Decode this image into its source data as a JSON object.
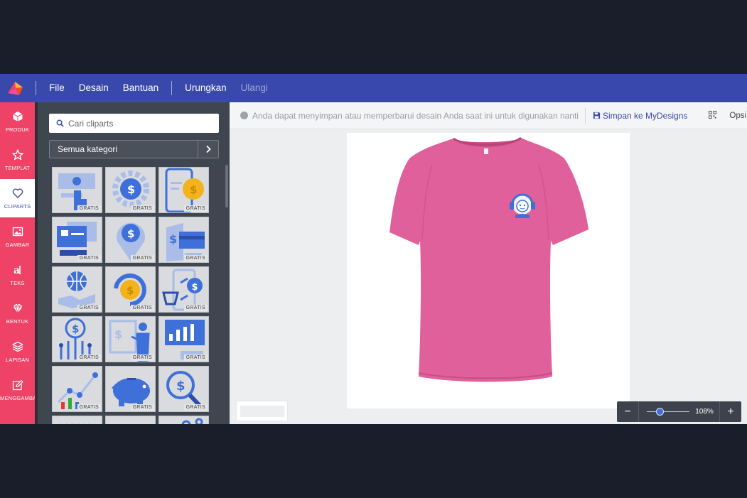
{
  "topbar": {
    "menu": [
      "File",
      "Desain",
      "Bantuan"
    ],
    "undo": "Urungkan",
    "redo": "Ulangi"
  },
  "sidebar": {
    "items": [
      {
        "label": "PRODUK",
        "icon": "box-icon"
      },
      {
        "label": "TEMPLAT",
        "icon": "star-icon"
      },
      {
        "label": "CLIPARTS",
        "icon": "heart-icon",
        "active": true
      },
      {
        "label": "GAMBAR",
        "icon": "image-icon"
      },
      {
        "label": "TEKS",
        "icon": "text-icon"
      },
      {
        "label": "BENTUK",
        "icon": "diamond-icon"
      },
      {
        "label": "LAPISAN",
        "icon": "layers-icon"
      },
      {
        "label": "MENGGAMBAR",
        "icon": "pencil-icon"
      }
    ]
  },
  "panel": {
    "search_placeholder": "Cari cliparts",
    "category": "Semua kategori",
    "badge": "GRATIS",
    "cliparts": [
      "cash-hand",
      "gear-dollar",
      "phone-coin",
      "card-terminal",
      "location-dollar",
      "wallet-card",
      "globe-hand",
      "coin-cycle",
      "phone-transfer",
      "dollar-circuit",
      "presentation",
      "monitor-chart",
      "growth-chart",
      "piggy-bank",
      "dollar-magnifier",
      "partial-1",
      "partial-2",
      "partial-3"
    ]
  },
  "infobar": {
    "message": "Anda dapat menyimpan atau memperbarui desain Anda saat ini untuk digunakan nanti",
    "save": "Simpan ke MyDesigns",
    "options": "Opsi"
  },
  "product": {
    "shirt_color": "#e0609b",
    "accent": "#3f6fd8"
  },
  "zoom": {
    "value": "108%",
    "minus": "−",
    "plus": "+",
    "level": 0.3
  },
  "colors": {
    "topbar": "#3949ab",
    "sidebar": "#ee4266",
    "panel": "#404650"
  }
}
